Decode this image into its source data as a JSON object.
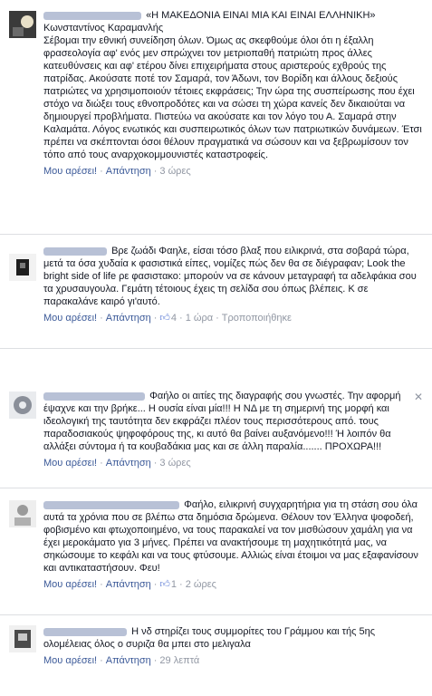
{
  "comments": [
    {
      "author_suffix": "«Η ΜΑΚΕΔΟΝΙΑ ΕΙΝΑΙ ΜΙΑ ΚΑΙ ΕΙΝΑΙ ΕΛΛΗΝΙΚΗ»",
      "subline": "Κωνσταντίνος Καραμανλής",
      "text": "Σέβομαι την εθνική συνείδηση όλων. Όμως ας σκεφθούμε όλοι ότι η έξαλλη φρασεολογία αφ' ενός μεν σπρώχνει τον μετριοπαθή πατριώτη προς άλλες κατευθύνσεις και αφ' ετέρου δίνει επιχειρήματα στους αριστερούς εχθρούς της πατρίδας. Ακούσατε ποτέ τον Σαμαρά, τον Άδωνι, τον Βορίδη και άλλους δεξιούς πατριώτες να χρησιμοποιούν τέτοιες εκφράσεις; Την ώρα της συσπείρωσης που έχει στόχο να διώξει τους εθνοπροδότες και να σώσει τη χώρα κανείς δεν δικαιούται να δημιουργεί προβλήματα. Πιστεύω να ακούσατε και τον λόγο του Α. Σαμαρά στην Καλαμάτα. Λόγος ενωτικός και συσπειρωτικός όλων των πατριωτικών δυνάμεων. Έτσι πρέπει να σκέπτονται όσοι θέλουν πραγματικά να σώσουν και να ξεβρωμίσουν τον τόπο από τους αναρχοκομμουνιστές καταστροφείς.",
      "like_label": "Μου αρέσει!",
      "reply_label": "Απάντηση",
      "time": "3 ώρες"
    },
    {
      "author_suffix": "Βρε ζωάδι Φαηλε,",
      "text": "είσαι τόσο βλαξ που ειλικρινά, στα σοβαρά τώρα, μετά τα όσα χυδαία κ φασιστικά είπες, νομίζες πώς δεν θα σε διέγραφαν; Look the bright side of life ρε φασιστακο: μπορούν να σε κάνουν μεταγραφή τα αδελφάκια σου τα χρυσαυγουλα. Γεμάτη τέτοιους έχεις τη σελίδα σου όπως βλέπεις. Κ σε παρακαλάνε καιρό γι'αυτό.",
      "like_label": "Μου αρέσει!",
      "reply_label": "Απάντηση",
      "likes": "4",
      "time": "1 ώρα",
      "edited_label": "Τροποποιήθηκε"
    },
    {
      "author_suffix": "Φαήλο οι αιτίες της διαγραφής σου γνωστές.",
      "text": "Την αφορμή έψαχνε και την βρήκε... Η ουσία είναι μία!!! Η ΝΔ με τη σημερινή της μορφή και ιδεολογική της ταυτότητα δεν εκφράζει πλέον τους περισσότερους από. τους παραδοσιακούς ψηφοφόρους της, κι αυτό θα βαίνει αυξανόμενο!!! Ή λοιπόν θα αλλάξει σύντομα ή τα κουβαδάκια μας και σε άλλη παραλία....... ΠΡΟΧΩΡΑ!!!",
      "like_label": "Μου αρέσει!",
      "reply_label": "Απάντηση",
      "time": "3 ώρες",
      "close_symbol": "✕"
    },
    {
      "author_suffix": "Φαήλο, ειλικρινή συγχαρητήρια για τη στάση",
      "text": "σου όλα αυτά τα χρόνια που σε βλέπω στα δημόσια δρώμενα. Θέλουν τον Έλληνα ψοφοδεή, φοβισμένο και φτωχοποιημένο, να τους παρακαλεί να τον μισθώσουν χαμάλη για να έχει μεροκάματο για 3 μήνες. Πρέπει να ανακτήσουμε τη μαχητικότητά μας, να σηκώσουμε το κεφάλι και να τους φτύσουμε. Αλλιώς είναι έτοιμοι να μας εξαφανίσουν και αντικαταστήσουν. Φευ!",
      "like_label": "Μου αρέσει!",
      "reply_label": "Απάντηση",
      "likes": "1",
      "time": "2 ώρες"
    },
    {
      "author_suffix": "Η νδ στηρίζει τους συμμορίτες του Γράμμου και τής 5ης",
      "text": "ολομέλειας όλος ο συριζα θα μπει στο μελιγαλα",
      "like_label": "Μου αρέσει!",
      "reply_label": "Απάντηση",
      "time": "29 λεπτά"
    }
  ],
  "colors": {
    "link": "#3b5998",
    "meta": "#9197a3",
    "text": "#141823",
    "separator": "#dddfe2"
  },
  "icons": {
    "like": "thumbs-up-icon",
    "close": "close-icon"
  }
}
